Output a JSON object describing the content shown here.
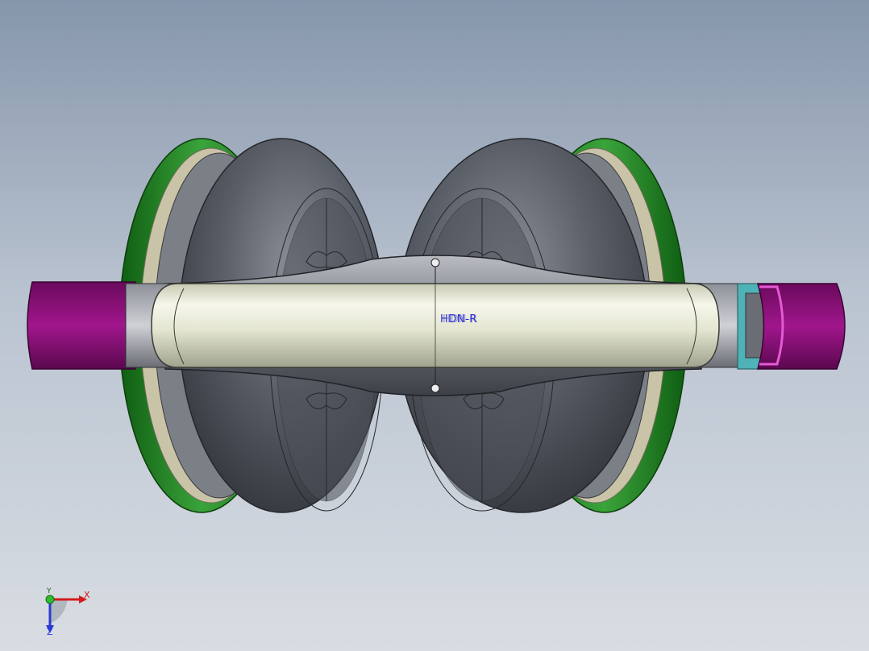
{
  "viewport": {
    "model_annotation": "HDN-R",
    "colors": {
      "cushion": "#4a4d55",
      "trim": "#2e8a2e",
      "cap": "#8a0a78",
      "headband": "#e8ead8",
      "annotation": "#2f2fcf"
    }
  },
  "triad": {
    "x_label": "X",
    "y_label": "Y",
    "z_label": "Z"
  }
}
